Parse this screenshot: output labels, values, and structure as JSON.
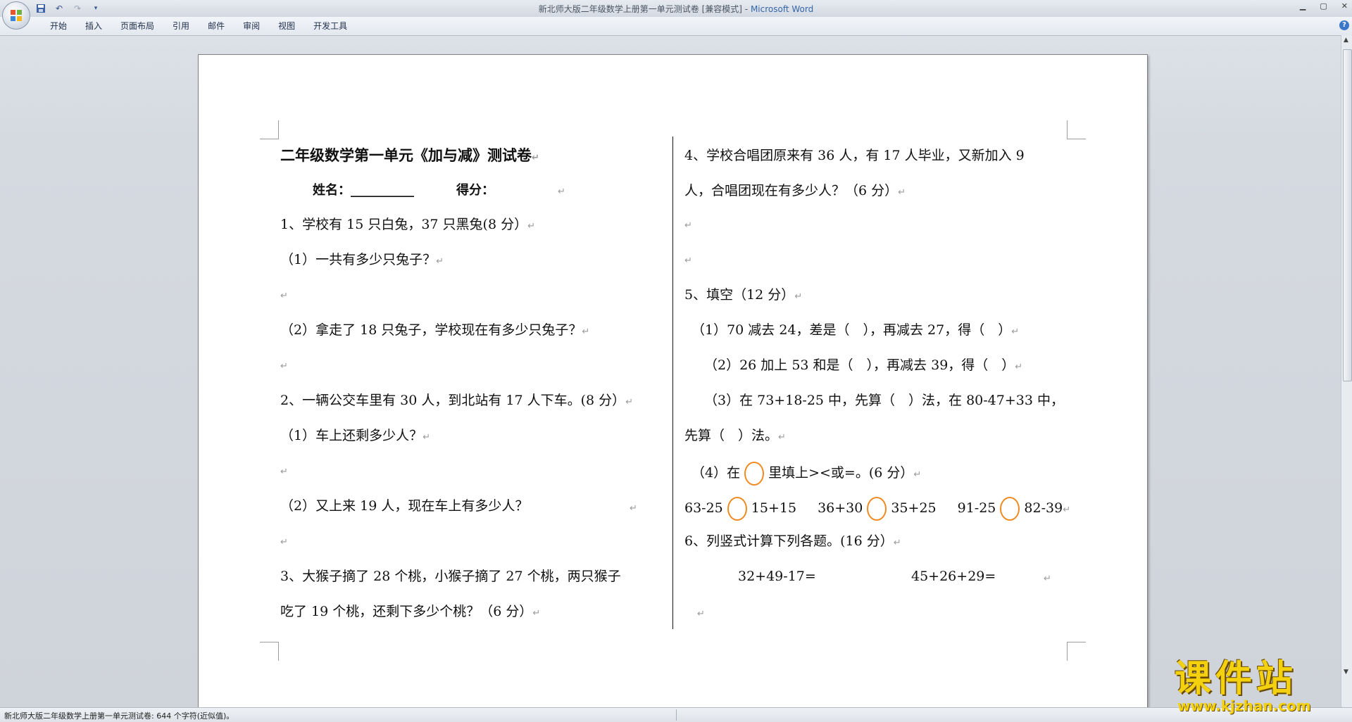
{
  "window": {
    "title_doc": "新北师大版二年级数学上册第一单元测试卷 [兼容模式]",
    "title_sep": " - ",
    "title_app": "Microsoft Word"
  },
  "qat": {
    "save_icon": "save-icon",
    "undo_icon": "undo-icon",
    "redo_icon": "redo-icon",
    "customize_icon": "customize-icon"
  },
  "ribbon": {
    "tabs": [
      "开始",
      "插入",
      "页面布局",
      "引用",
      "邮件",
      "审阅",
      "视图",
      "开发工具"
    ],
    "help": "?"
  },
  "document": {
    "left": {
      "title": "二年级数学第一单元《加与减》测试卷",
      "name_label": "姓名：",
      "name_blank": "__________",
      "score_label": "得分：",
      "q1": "1、学校有 15 只白兔，37 只黑兔(8 分）",
      "q1_1": "（1）一共有多少只兔子？",
      "q1_2": "（2）拿走了 18 只兔子，学校现在有多少只兔子？",
      "q2": "2、一辆公交车里有 30 人，到北站有 17 人下车。(8 分）",
      "q2_1": "（1）车上还剩多少人？",
      "q2_2": "（2）又上来 19 人，现在车上有多少人？",
      "q3_a": "3、大猴子摘了 28 个桃，小猴子摘了 27 个桃，两只猴子",
      "q3_b": "吃了 19 个桃，还剩下多少个桃？（6 分）"
    },
    "right": {
      "q4_a": "4、学校合唱团原来有 36 人，有 17 人毕业，又新加入 9",
      "q4_b": "人，合唱团现在有多少人？（6 分）",
      "q5": "5、填空（12 分）",
      "q5_1": "（1）70 减去 24，差是（　），再减去 27，得（　）",
      "q5_2": "（2）26 加上 53 和是（　），再减去 39，得（　）",
      "q5_3a": "（3）在 73+18-25 中，先算（　）法，在 80-47+33 中，",
      "q5_3b": "先算（　）法。",
      "q5_4_pre": "（4）在",
      "q5_4_post": "里填上>",
      "q5_4_tail": "<或=。(6 分）",
      "cmp1_a": "63-25",
      "cmp1_b": "15+15",
      "cmp2_a": "36+30",
      "cmp2_b": "35+25",
      "cmp3_a": "91-25",
      "cmp3_b": "82-39",
      "q6": "6、列竖式计算下列各题。(16 分）",
      "q6_e1": "32+49-17=",
      "q6_e2": "45+26+29="
    },
    "paragraph_mark": "↵"
  },
  "statusbar": {
    "text": "新北师大版二年级数学上册第一单元测试卷: 644 个字符(近似值)。"
  },
  "watermark": {
    "main": "课件站",
    "url": "www.kjzhan.com"
  },
  "colors": {
    "circle": "#ef8a21",
    "watermark": "#f3d10e",
    "title_app": "#3566a8"
  }
}
